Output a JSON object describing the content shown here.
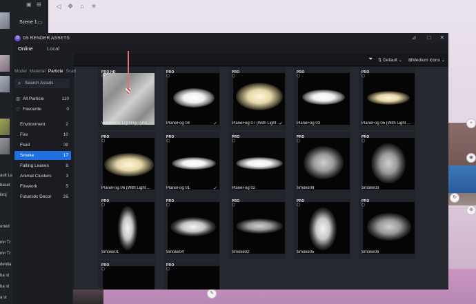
{
  "scene_panel": {
    "scene_title": "Scene 1",
    "labels": [
      "ault La",
      "baset",
      "kroj",
      "orted",
      "mn Tr",
      "mn Tr",
      "dentia",
      "ba st",
      "ba st",
      "a st"
    ]
  },
  "window": {
    "title": "D5 RENDER ASSETS",
    "tabs": [
      "Online",
      "Local"
    ],
    "active_tab": "Online"
  },
  "sub_tabs": {
    "items": [
      "Model",
      "Material",
      "Particle",
      "Scatt"
    ],
    "active": "Particle"
  },
  "search": {
    "placeholder": "Search Assets"
  },
  "filters": [
    {
      "label": "All Particle",
      "count": "110",
      "icon": "grid-icon"
    },
    {
      "label": "Favourite",
      "count": "0",
      "icon": "heart-icon"
    }
  ],
  "categories": [
    {
      "label": "Environment",
      "count": "2"
    },
    {
      "label": "Fire",
      "count": "10"
    },
    {
      "label": "Fluid",
      "count": "39"
    },
    {
      "label": "Smoke",
      "count": "17",
      "active": true
    },
    {
      "label": "Falling Leaves",
      "count": "8"
    },
    {
      "label": "Animal Clusters",
      "count": "3"
    },
    {
      "label": "Firework",
      "count": "5"
    },
    {
      "label": "Futuristic Decor",
      "count": "26"
    }
  ],
  "toolbar": {
    "sort_label": "Default",
    "view_label": "Medium Icons"
  },
  "assets": [
    {
      "badge": "PRO HD",
      "name": "Volumetric Lighting(Tynd...",
      "check": true
    },
    {
      "badge": "PRO",
      "name": "PlaneFog 04",
      "check": true
    },
    {
      "badge": "PRO",
      "name": "PlaneFog 07 (With Light N...",
      "check": true
    },
    {
      "badge": "PRO",
      "name": "PlaneFog 03",
      "check": false
    },
    {
      "badge": "PRO",
      "name": "PlaneFog 05 (With Light ...",
      "check": false
    },
    {
      "badge": "PRO",
      "name": "PlaneFog 06 (With Light ...",
      "check": false
    },
    {
      "badge": "PRO",
      "name": "PlaneFog 01",
      "check": true
    },
    {
      "badge": "PRO",
      "name": "PlaneFog 02",
      "check": false
    },
    {
      "badge": "PRO",
      "name": "Smoke09",
      "check": false
    },
    {
      "badge": "PRO",
      "name": "Smoke03",
      "check": false
    },
    {
      "badge": "PRO",
      "name": "Smoke01",
      "check": false
    },
    {
      "badge": "PRO",
      "name": "Smoke04",
      "check": false
    },
    {
      "badge": "PRO",
      "name": "Smoke02",
      "check": false
    },
    {
      "badge": "PRO",
      "name": "Smoke05",
      "check": false
    },
    {
      "badge": "PRO",
      "name": "Smoke06",
      "check": false
    },
    {
      "badge": "PRO",
      "name": "",
      "check": false
    },
    {
      "badge": "PRO",
      "name": "",
      "check": false
    }
  ]
}
